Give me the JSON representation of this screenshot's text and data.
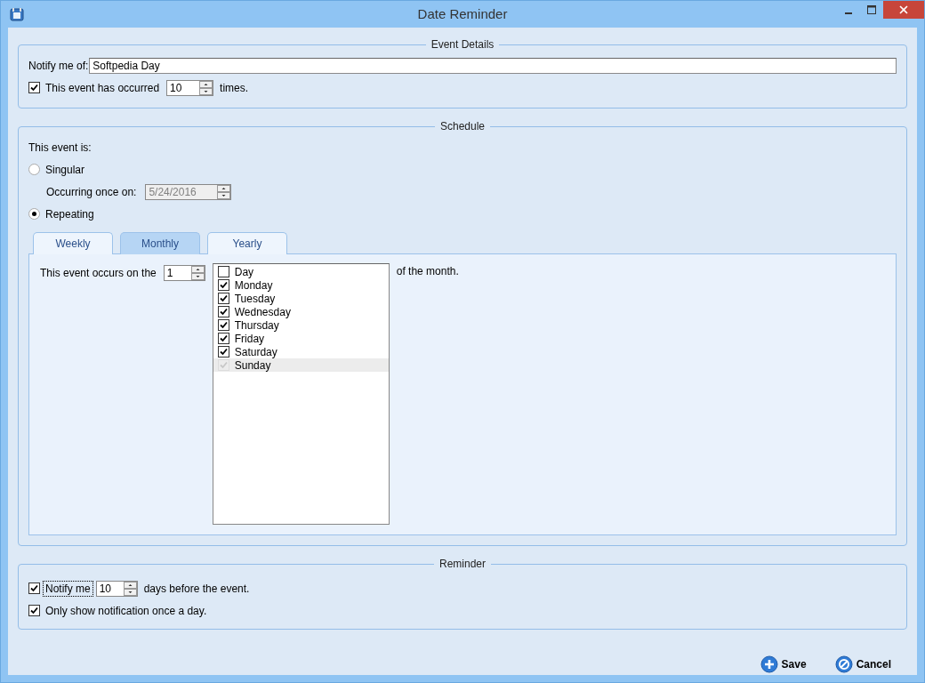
{
  "window": {
    "title": "Date Reminder"
  },
  "event_details": {
    "title": "Event Details",
    "notify_label": "Notify me of:",
    "notify_value": "Softpedia Day",
    "occurred": {
      "checked": true,
      "label": "This event has occurred",
      "count": "10",
      "suffix": "times."
    }
  },
  "schedule": {
    "title": "Schedule",
    "prompt": "This event is:",
    "options": [
      {
        "label": "Singular",
        "selected": false
      },
      {
        "label": "Repeating",
        "selected": true
      }
    ],
    "once_label": "Occurring once on:",
    "once_date": "5/24/2016",
    "tabs": [
      {
        "label": "Weekly",
        "selected": false
      },
      {
        "label": "Monthly",
        "selected": true
      },
      {
        "label": "Yearly",
        "selected": false
      }
    ],
    "monthly": {
      "label": "This event occurs on the",
      "day": "1",
      "suffix": "of the month.",
      "days": [
        {
          "label": "Day",
          "checked": false,
          "selected": false
        },
        {
          "label": "Monday",
          "checked": true,
          "selected": false
        },
        {
          "label": "Tuesday",
          "checked": true,
          "selected": false
        },
        {
          "label": "Wednesday",
          "checked": true,
          "selected": false
        },
        {
          "label": "Thursday",
          "checked": true,
          "selected": false
        },
        {
          "label": "Friday",
          "checked": true,
          "selected": false
        },
        {
          "label": "Saturday",
          "checked": true,
          "selected": false
        },
        {
          "label": "Sunday",
          "checked": true,
          "selected": true
        }
      ]
    }
  },
  "reminder": {
    "title": "Reminder",
    "notify": {
      "checked": true,
      "label": "Notify me",
      "days": "10",
      "suffix": "days before the event."
    },
    "once_a_day": {
      "checked": true,
      "label": "Only show notification once a day."
    }
  },
  "buttons": [
    {
      "label": "Save",
      "kind": "save"
    },
    {
      "label": "Cancel",
      "kind": "cancel"
    }
  ]
}
